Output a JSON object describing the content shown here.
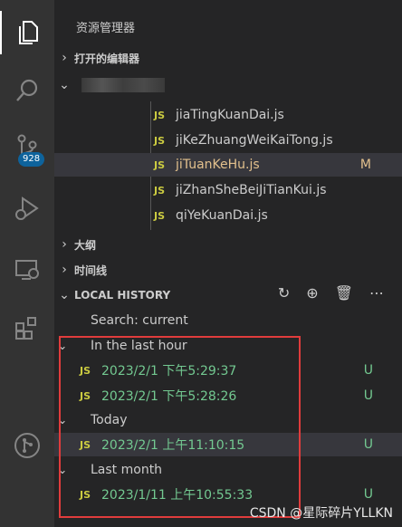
{
  "activity_bar": {
    "items": [
      {
        "icon": "files-icon",
        "active": true
      },
      {
        "icon": "search-icon"
      },
      {
        "icon": "source-control-icon",
        "badge": "928"
      },
      {
        "icon": "run-debug-icon"
      },
      {
        "icon": "remote-explorer-icon"
      },
      {
        "icon": "extensions-icon"
      },
      {
        "icon": "git-graph-icon"
      }
    ]
  },
  "sidebar": {
    "title": "资源管理器",
    "open_editors": "打开的编辑器",
    "files": [
      {
        "name": "jiaTingKuanDai.js",
        "badge": "JS"
      },
      {
        "name": "jiKeZhuangWeiKaiTong.js",
        "badge": "JS"
      },
      {
        "name": "jiTuanKeHu.js",
        "badge": "JS",
        "status": "M",
        "selected": true
      },
      {
        "name": "jiZhanSheBeiJiTianKui.js",
        "badge": "JS"
      },
      {
        "name": "qiYeKuanDai.js",
        "badge": "JS"
      }
    ],
    "outline": "大纲",
    "timeline": "时间线",
    "local_history": {
      "title": "LOCAL HISTORY",
      "search": "Search: current",
      "groups": [
        {
          "label": "In the last hour",
          "entries": [
            {
              "badge": "JS",
              "label": "2023/2/1 下午5:29:37",
              "status": "U"
            },
            {
              "badge": "JS",
              "label": "2023/2/1 下午5:28:26",
              "status": "U"
            }
          ]
        },
        {
          "label": "Today",
          "entries": [
            {
              "badge": "JS",
              "label": "2023/2/1 上午11:10:15",
              "status": "U",
              "selected": true
            }
          ]
        },
        {
          "label": "Last month",
          "entries": [
            {
              "badge": "JS",
              "label": "2023/1/11 上午10:55:33",
              "status": "U"
            }
          ]
        }
      ]
    }
  },
  "watermark": "CSDN @星际碎片YLLKN",
  "colors": {
    "highlight_box": "#e03c3c",
    "untracked_green": "#73c991",
    "modified_yellow": "#e2c08d",
    "js_yellow": "#cbcb41"
  }
}
